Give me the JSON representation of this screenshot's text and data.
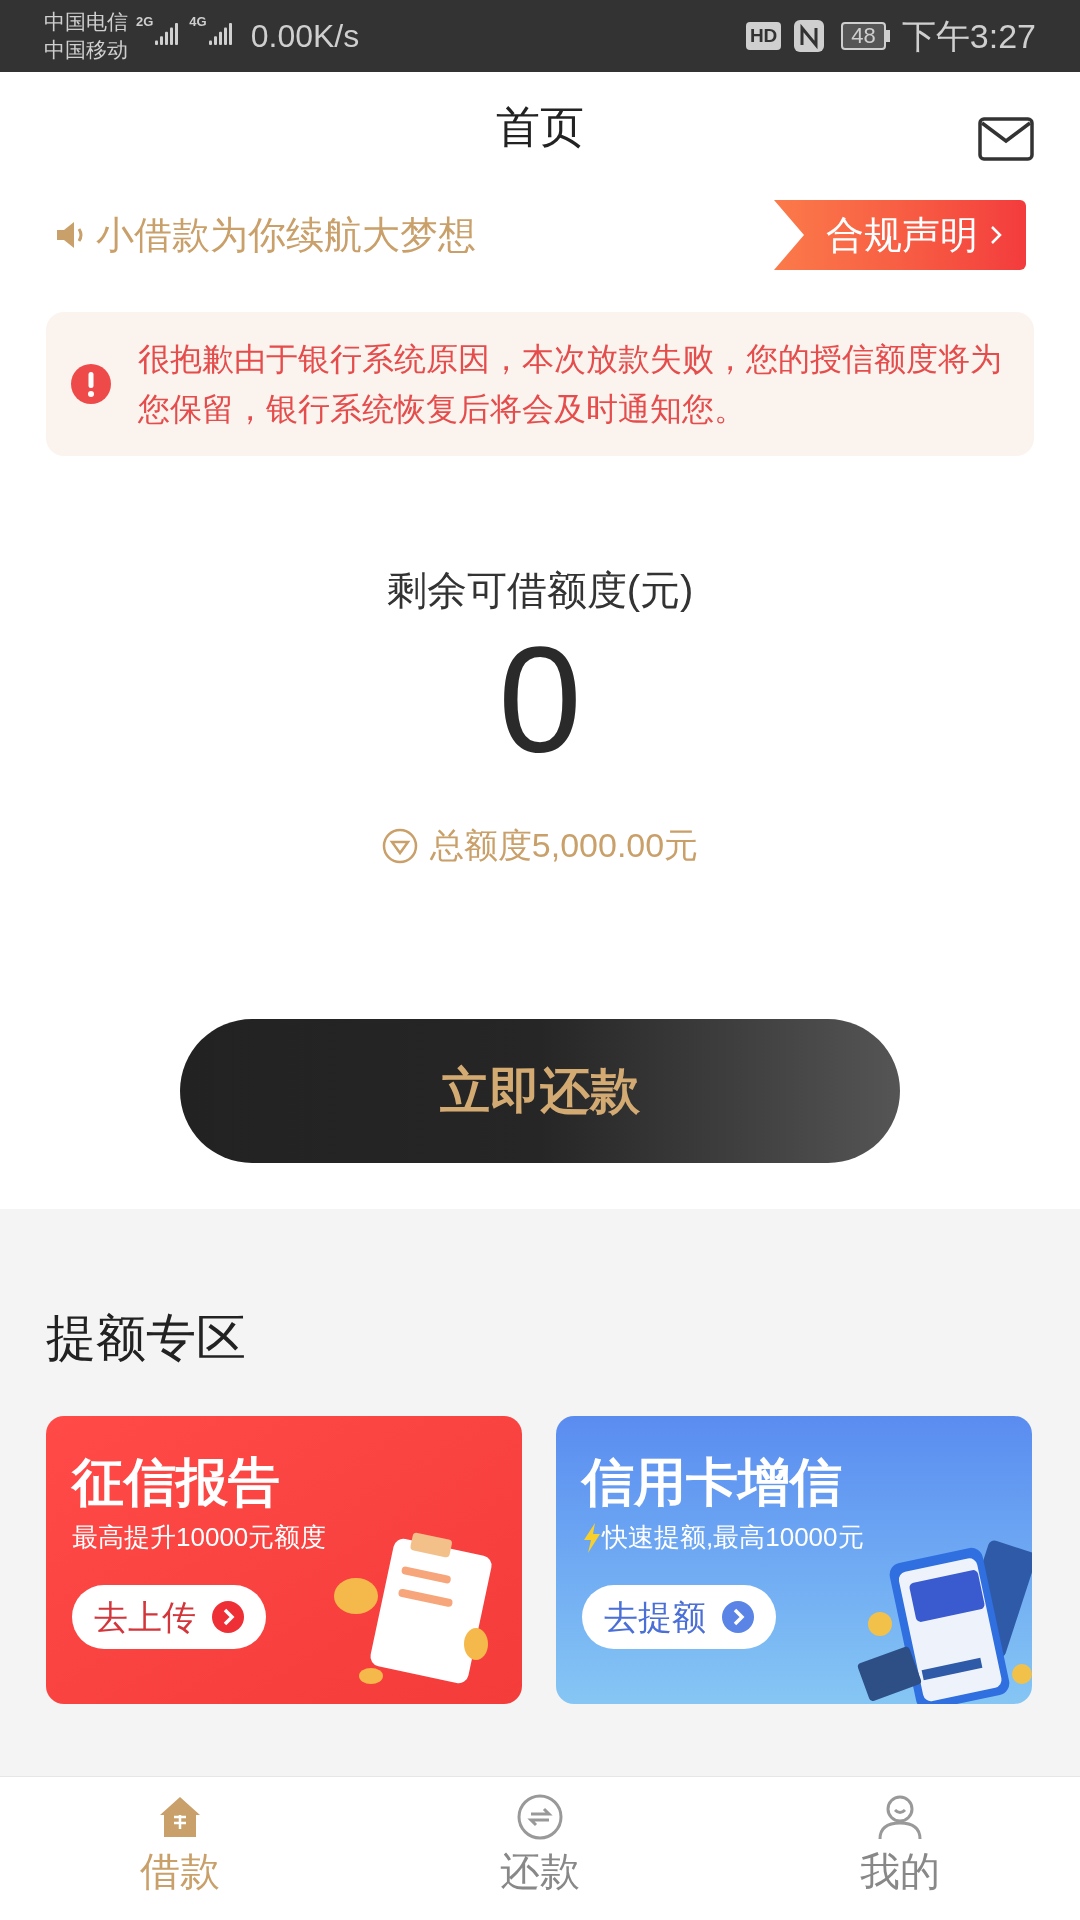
{
  "status_bar": {
    "carrier_1": "中国电信",
    "carrier_2": "中国移动",
    "network_1": "2G",
    "network_2": "4G",
    "speed": "0.00K/s",
    "hd": "HD",
    "battery": "48",
    "time": "下午3:27"
  },
  "header": {
    "title": "首页"
  },
  "notice": {
    "text": "小借款为你续航大梦想",
    "button": "合规声明"
  },
  "alert": {
    "text": "很抱歉由于银行系统原因，本次放款失败，您的授信额度将为您保留，银行系统恢复后将会及时通知您。"
  },
  "credit": {
    "label": "剩余可借额度(元)",
    "amount": "0",
    "total": "总额度5,000.00元"
  },
  "action_button": "立即还款",
  "section": {
    "title": "提额专区",
    "cards": [
      {
        "kind": "report",
        "title": "征信报告",
        "subtitle": "最高提升10000元额度",
        "button": "去上传"
      },
      {
        "kind": "card",
        "title": "信用卡增信",
        "subtitle": "快速提额,最高10000元",
        "button": "去提额"
      }
    ]
  },
  "nav": [
    {
      "kind": "home",
      "label": "借款",
      "selected": true
    },
    {
      "kind": "repay",
      "label": "还款",
      "selected": false
    },
    {
      "kind": "user",
      "label": "我的",
      "selected": false
    }
  ]
}
